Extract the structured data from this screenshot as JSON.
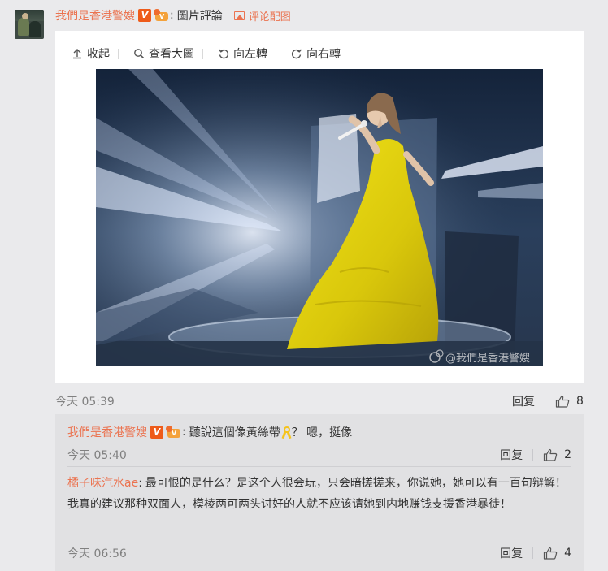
{
  "post": {
    "author": "我們是香港警嫂",
    "colon": ":",
    "text": "圖片評論",
    "image_comment_link": "评论配图"
  },
  "toolbar": {
    "collapse": "收起",
    "view_large": "查看大圖",
    "rotate_left": "向左轉",
    "rotate_right": "向右轉"
  },
  "photo": {
    "watermark": "@我們是香港警嫂"
  },
  "meta": {
    "time": "今天 05:39",
    "reply_label": "回复",
    "like_count": "8"
  },
  "replies": [
    {
      "author": "我們是香港警嫂",
      "colon": ":",
      "text_before": "聽說這個像黃絲帶",
      "text_after": "？ 嗯，挺像",
      "time": "今天 05:40",
      "reply_label": "回复",
      "like_count": "2"
    },
    {
      "author": "橘子味汽水ae",
      "colon": ":",
      "text": "最可恨的是什么？是这个人很会玩，只会暗搓搓来，你说她，她可以有一百句辩解！我真的建议那种双面人，模棱两可两头讨好的人就不应该请她到内地赚钱支援香港暴徒！",
      "time": "今天 06:56",
      "reply_label": "回复",
      "like_count": "4"
    }
  ],
  "colors": {
    "accent": "#eb7350",
    "vip_badge": "#ee5b1a",
    "dress": "#e3d20a"
  },
  "icons": {
    "collapse": "arrow-up-icon",
    "view_large": "magnifier-icon",
    "rotate_left": "rotate-left-icon",
    "rotate_right": "rotate-right-icon",
    "like": "thumbs-up-icon",
    "image": "image-icon",
    "badge": "verified-v-icon",
    "crown": "vip-crown-icon",
    "ribbon": "yellow-ribbon-icon"
  }
}
